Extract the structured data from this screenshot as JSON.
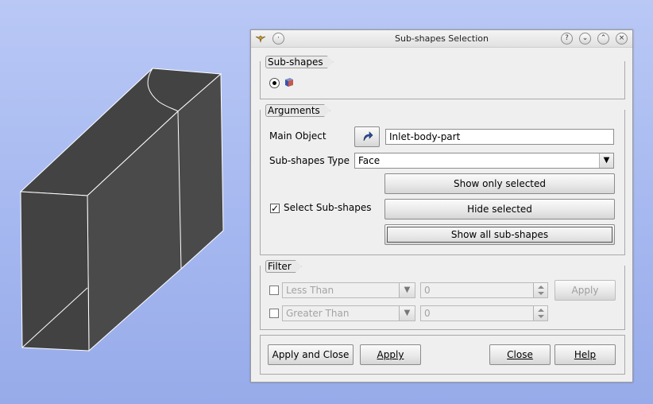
{
  "window": {
    "title": "Sub-shapes Selection"
  },
  "titlebar_buttons": [
    "help-icon",
    "minimize-icon",
    "maximize-icon",
    "close-icon"
  ],
  "subshapes": {
    "group_title": "Sub-shapes",
    "selected_mode": "single"
  },
  "arguments": {
    "group_title": "Arguments",
    "main_object_label": "Main Object",
    "main_object_value": "Inlet-body-part",
    "subshapes_type_label": "Sub-shapes Type",
    "subshapes_type_value": "Face",
    "select_subshapes_label": "Select Sub-shapes",
    "select_subshapes_checked": true,
    "show_only_selected": "Show only selected",
    "hide_selected": "Hide selected",
    "show_all": "Show all sub-shapes"
  },
  "filter": {
    "group_title": "Filter",
    "less_than_label": "Less Than",
    "less_than_value": "0",
    "greater_than_label": "Greater Than",
    "greater_than_value": "0",
    "apply_label": "Apply"
  },
  "footer": {
    "apply_and_close": "Apply and Close",
    "apply": "Apply",
    "close": "Close",
    "help": "Help"
  },
  "colors": {
    "model_face": "#464646",
    "model_edge": "#ffffff",
    "background": "#a7b9f0"
  }
}
